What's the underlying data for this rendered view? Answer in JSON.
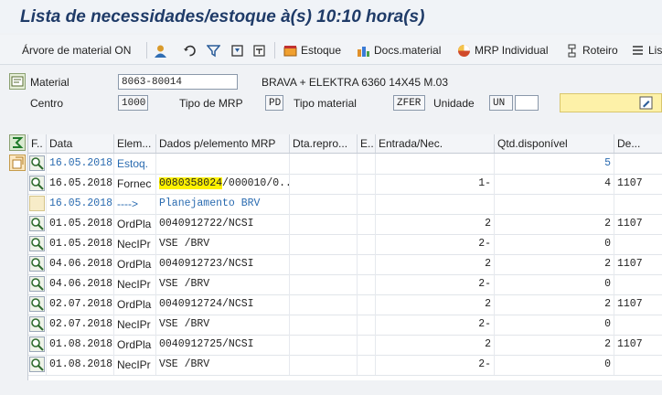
{
  "title": "Lista de necessidades/estoque à(s) 10:10 hora(s)",
  "toolbar": {
    "tree": "Árvore de material ON",
    "stock": "Estoque",
    "docs": "Docs.material",
    "mrp": "MRP Individual",
    "route": "Roteiro",
    "more": "Lis"
  },
  "form": {
    "material_label": "Material",
    "material_value": "8063-80014",
    "material_desc": "BRAVA + ELEKTRA 6360 14X45 M.03",
    "centro_label": "Centro",
    "centro_value": "1000",
    "tipo_mrp_label": "Tipo de MRP",
    "tipo_mrp_value": "PD",
    "tipo_material_label": "Tipo material",
    "tipo_material_value": "ZFER",
    "unidade_label": "Unidade",
    "unidade_value": "UN"
  },
  "table": {
    "headers": [
      "F..",
      "Data",
      "Elem...",
      "Dados p/elemento MRP",
      "Dta.repro...",
      "E..",
      "Entrada/Nec.",
      "Qtd.disponível",
      "De..."
    ],
    "rows": [
      {
        "data": "16.05.2018",
        "elem": "Estoq.",
        "dados": "",
        "entrada": "",
        "qtd": "5",
        "dep": ""
      },
      {
        "data": "16.05.2018",
        "elem": "Fornec",
        "dados_hl": "0080358024",
        "dados": "/000010/0...",
        "entrada": "1-",
        "qtd": "4",
        "dep": "1107"
      },
      {
        "data": "16.05.2018",
        "elem": "---->",
        "dados": "Planejamento BRV",
        "entrada": "",
        "qtd": "",
        "dep": ""
      },
      {
        "data": "01.05.2018",
        "elem": "OrdPla",
        "dados": "0040912722/NCSI",
        "entrada": "2",
        "qtd": "2",
        "dep": "1107"
      },
      {
        "data": "01.05.2018",
        "elem": "NecIPr",
        "dados": "VSE /BRV",
        "entrada": "2-",
        "qtd": "0",
        "dep": ""
      },
      {
        "data": "04.06.2018",
        "elem": "OrdPla",
        "dados": "0040912723/NCSI",
        "entrada": "2",
        "qtd": "2",
        "dep": "1107"
      },
      {
        "data": "04.06.2018",
        "elem": "NecIPr",
        "dados": "VSE /BRV",
        "entrada": "2-",
        "qtd": "0",
        "dep": ""
      },
      {
        "data": "02.07.2018",
        "elem": "OrdPla",
        "dados": "0040912724/NCSI",
        "entrada": "2",
        "qtd": "2",
        "dep": "1107"
      },
      {
        "data": "02.07.2018",
        "elem": "NecIPr",
        "dados": "VSE /BRV",
        "entrada": "2-",
        "qtd": "0",
        "dep": ""
      },
      {
        "data": "01.08.2018",
        "elem": "OrdPla",
        "dados": "0040912725/NCSI",
        "entrada": "2",
        "qtd": "2",
        "dep": "1107"
      },
      {
        "data": "01.08.2018",
        "elem": "NecIPr",
        "dados": "VSE /BRV",
        "entrada": "2-",
        "qtd": "0",
        "dep": ""
      }
    ]
  },
  "colors": {
    "title": "#1f3b68",
    "link_blue": "#2a6bb0",
    "highlight": "#fff200"
  }
}
